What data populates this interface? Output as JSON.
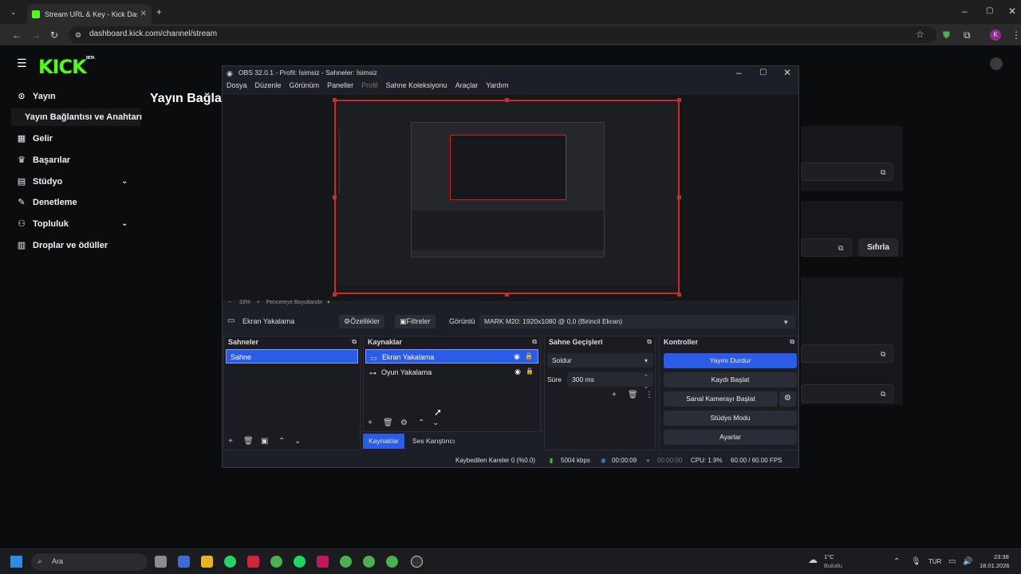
{
  "browser": {
    "tab_title": "Stream URL & Key - Kick Dashb",
    "url": "dashboard.kick.com/channel/stream",
    "profile_initial": "K"
  },
  "kick": {
    "logo": "KICK",
    "logo_badge": "BETA",
    "page_title": "Yayın Bağla",
    "nav": [
      {
        "label": "Yayın",
        "icon": "broadcast-icon"
      },
      {
        "label": "Yayın Bağlantısı ve Anahtarı",
        "icon": ""
      },
      {
        "label": "Gelir",
        "icon": "revenue-icon"
      },
      {
        "label": "Başarılar",
        "icon": "trophy-icon"
      },
      {
        "label": "Stüdyo",
        "icon": "studio-icon"
      },
      {
        "label": "Denetleme",
        "icon": "wrench-icon"
      },
      {
        "label": "Topluluk",
        "icon": "community-icon"
      },
      {
        "label": "Droplar ve ödüller",
        "icon": "drops-icon"
      }
    ],
    "reset_label": "Sıfırla"
  },
  "obs": {
    "title": "OBS 32.0.1 - Profil: İsimsiz - Sahneler: İsimsiz",
    "menu": [
      "Dosya",
      "Düzenle",
      "Görünüm",
      "Paneller",
      "Profil",
      "Sahne Koleksiyonu",
      "Araçlar",
      "Yardım"
    ],
    "zoom": "33%",
    "fit_label": "Pencereye Boyutlandır",
    "source_selected": "Ekran Yakalama",
    "properties": "Özellikler",
    "filters": "Filtreler",
    "display_label": "Görüntü",
    "display_value": "MARK M20: 1920x1080 @ 0,0 (Birincil Ekran)",
    "scenes_title": "Sahneler",
    "scenes": [
      "Sahne"
    ],
    "sources_title": "Kaynaklar",
    "sources": [
      "Ekran Yakalama",
      "Oyun Yakalama"
    ],
    "transitions_title": "Sahne Geçişleri",
    "transition": "Soldur",
    "duration_label": "Süre",
    "duration": "300 ms",
    "controls_title": "Kontroller",
    "controls": [
      "Yayını Durdur",
      "Kaydı Başlat",
      "Sanal Kamerayı Başlat",
      "Stüdyo Modu",
      "Ayarlar"
    ],
    "tab_sources": "Kaynaklar",
    "tab_mixer": "Ses Karıştırıcı",
    "status": {
      "dropped": "Kaybedilen Kareler 0 (%0.0)",
      "bitrate": "5004 kbps",
      "stream_time": "00:00:09",
      "rec_time": "00:00:00",
      "cpu": "CPU: 1.9%",
      "fps": "60.00 / 60.00 FPS"
    }
  },
  "taskbar": {
    "search": "Ara",
    "weather_temp": "1°C",
    "weather_desc": "Bulutlu",
    "lang": "TUR",
    "time": "23:38",
    "date": "18.01.2026"
  },
  "colors": {
    "kick_green": "#53fc18",
    "obs_accent": "#2c5ce6",
    "selection_red": "#d42828"
  }
}
